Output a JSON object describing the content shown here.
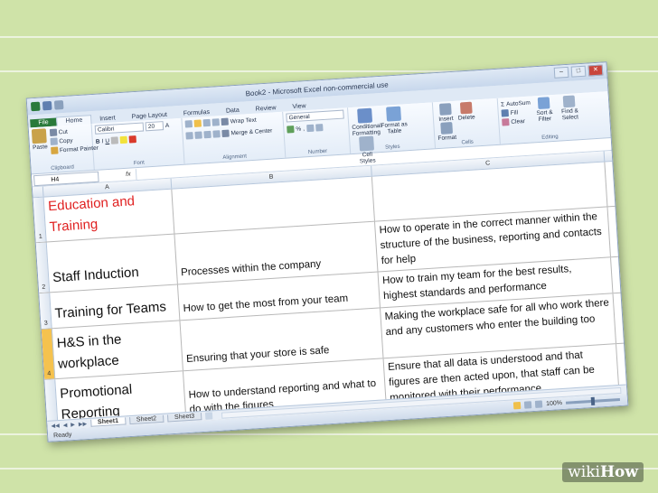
{
  "window": {
    "title": "Book2 - Microsoft Excel non-commercial use"
  },
  "tabs": [
    "File",
    "Home",
    "Insert",
    "Page Layout",
    "Formulas",
    "Data",
    "Review",
    "View"
  ],
  "active_tab": "Home",
  "ribbon": {
    "clipboard": {
      "paste": "Paste",
      "cut": "Cut",
      "copy": "Copy",
      "format_painter": "Format Painter",
      "label": "Clipboard"
    },
    "font": {
      "name": "Calibri",
      "size": "20",
      "bold": "B",
      "italic": "I",
      "underline": "U",
      "label": "Font"
    },
    "alignment": {
      "wrap": "Wrap Text",
      "merge": "Merge & Center",
      "label": "Alignment"
    },
    "number": {
      "format": "General",
      "percent": "%",
      "comma": ",",
      "label": "Number"
    },
    "styles": {
      "conditional": "Conditional Formatting",
      "format_table": "Format as Table",
      "cell_styles": "Cell Styles",
      "label": "Styles"
    },
    "cells": {
      "insert": "Insert",
      "delete": "Delete",
      "format": "Format",
      "label": "Cells"
    },
    "editing": {
      "autosum": "AutoSum",
      "fill": "Fill",
      "clear": "Clear",
      "sort": "Sort & Filter",
      "find": "Find & Select",
      "label": "Editing"
    }
  },
  "formula_bar": {
    "name_box": "H4",
    "fx": "fx",
    "value": ""
  },
  "columns": [
    "A",
    "B",
    "C"
  ],
  "rows": [
    {
      "num": "1",
      "a": "Education and Training",
      "b": "",
      "c": ""
    },
    {
      "num": "2",
      "a": "Staff Induction",
      "b": "Processes within the company",
      "c": "How to operate in the correct manner within the structure of the business, reporting and contacts for help"
    },
    {
      "num": "3",
      "a": "Training for Teams",
      "b": "How to get the most from your team",
      "c": "How to train my team for the best results, highest standards and performance"
    },
    {
      "num": "4",
      "a": "H&S in the workplace",
      "b": "Ensuring that your store is safe",
      "c": "Making the workplace safe for all who work there and any customers who enter the building too"
    },
    {
      "num": "5",
      "a": "Promotional Reporting",
      "b": "How to understand reporting and what to do with the figures",
      "c": "Ensure that all data is understood and that figures are then acted upon, that staff can be monitored with their performance"
    }
  ],
  "sheets": [
    "Sheet1",
    "Sheet2",
    "Sheet3"
  ],
  "status": {
    "ready": "Ready",
    "zoom": "100%"
  },
  "watermark": {
    "wiki": "wiki",
    "how": "How"
  },
  "colors": {
    "accent_red": "#e02020",
    "file_tab": "#2a7a3b",
    "selected_row": "#f5c24e"
  }
}
